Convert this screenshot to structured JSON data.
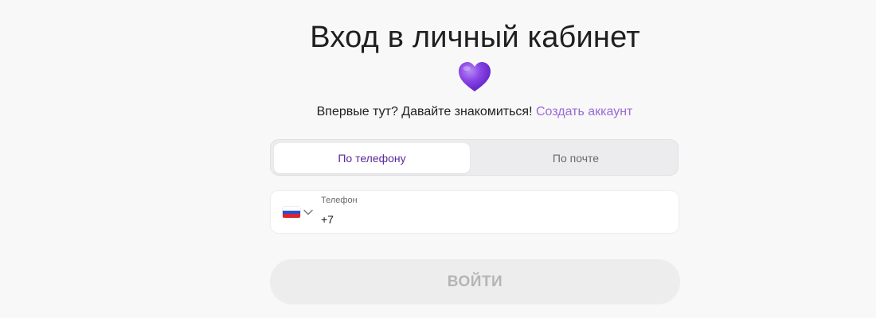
{
  "header": {
    "title": "Вход в личный кабинет",
    "heart_icon": "purple-heart-icon"
  },
  "signup": {
    "prompt": "Впервые тут? Давайте знакомиться!",
    "link_label": "Создать аккаунт",
    "link_color": "#9a6ad6"
  },
  "tabs": [
    {
      "label": "По телефону",
      "active": true
    },
    {
      "label": "По почте",
      "active": false
    }
  ],
  "phone_field": {
    "label": "Телефон",
    "value": "+7",
    "country_icon": "russia-flag-icon",
    "dropdown_icon": "chevron-down-icon"
  },
  "submit": {
    "label": "ВОЙТИ"
  },
  "colors": {
    "accent": "#5b2a9a",
    "link": "#9a6ad6",
    "background": "#f8f8f8"
  }
}
